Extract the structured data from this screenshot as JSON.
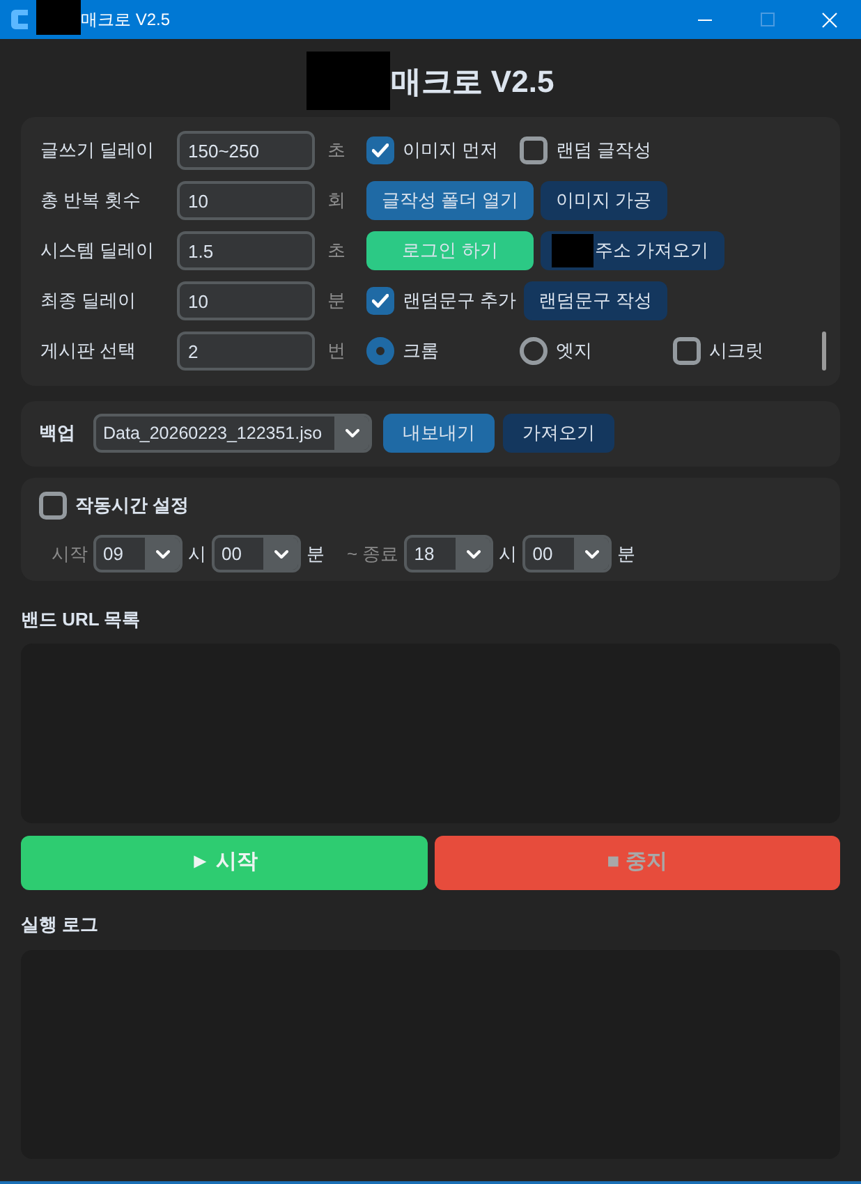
{
  "window": {
    "title": "매크로 V2.5",
    "redacted_prefix": true,
    "controls": [
      {
        "kind": "minimize",
        "disabled": false
      },
      {
        "kind": "maximize",
        "disabled": true
      },
      {
        "kind": "close",
        "disabled": false
      }
    ]
  },
  "header": {
    "title": "매크로 V2.5",
    "redacted_prefix": true
  },
  "settings": {
    "rows": [
      {
        "label": "글쓰기 딜레이",
        "value": "150~250",
        "unit": "초",
        "items": [
          {
            "kind": "checkbox",
            "label": "이미지 먼저",
            "checked": true
          },
          {
            "kind": "checkbox",
            "label": "랜덤 글작성",
            "checked": false
          }
        ]
      },
      {
        "label": "총 반복 횟수",
        "value": "10",
        "unit": "회",
        "items": [
          {
            "kind": "button",
            "label": "글작성 폴더 열기"
          },
          {
            "kind": "button",
            "label": "이미지 가공"
          }
        ]
      },
      {
        "label": "시스템 딜레이",
        "value": "1.5",
        "unit": "초",
        "items": [
          {
            "kind": "button",
            "label": "로그인 하기"
          },
          {
            "kind": "button",
            "label": "주소 가져오기",
            "redacted_prefix": true
          }
        ]
      },
      {
        "label": "최종 딜레이",
        "value": "10",
        "unit": "분",
        "items": [
          {
            "kind": "checkbox",
            "label": "랜덤문구 추가",
            "checked": true
          },
          {
            "kind": "button",
            "label": "랜덤문구 작성"
          }
        ]
      },
      {
        "label": "게시판 선택",
        "value": "2",
        "unit": "번",
        "items": [
          {
            "kind": "radio",
            "label": "크롬",
            "selected": true
          },
          {
            "kind": "radio",
            "label": "엣지",
            "selected": false
          },
          {
            "kind": "checkbox",
            "label": "시크릿",
            "checked": false
          }
        ]
      }
    ]
  },
  "backup": {
    "label": "백업",
    "file": "Data_20260223_122351.jso",
    "buttons": [
      {
        "label": "내보내기"
      },
      {
        "label": "가져오기"
      }
    ]
  },
  "schedule": {
    "label": "작동시간 설정",
    "checked": false,
    "fields": [
      {
        "kind": "label",
        "text": "시작"
      },
      {
        "kind": "select",
        "value": "09"
      },
      {
        "kind": "unit",
        "text": "시"
      },
      {
        "kind": "select",
        "value": "00"
      },
      {
        "kind": "unit",
        "text": "분"
      },
      {
        "kind": "label",
        "text": "~ 종료"
      },
      {
        "kind": "select",
        "value": "18"
      },
      {
        "kind": "unit",
        "text": "시"
      },
      {
        "kind": "select",
        "value": "00"
      },
      {
        "kind": "unit",
        "text": "분"
      }
    ]
  },
  "url_list": {
    "label": "밴드 URL 목록"
  },
  "actions": [
    {
      "kind": "start",
      "label": "► 시작",
      "disabled": false
    },
    {
      "kind": "stop",
      "label": "■ 중지",
      "disabled": true
    }
  ],
  "log": {
    "label": "실행 로그"
  }
}
